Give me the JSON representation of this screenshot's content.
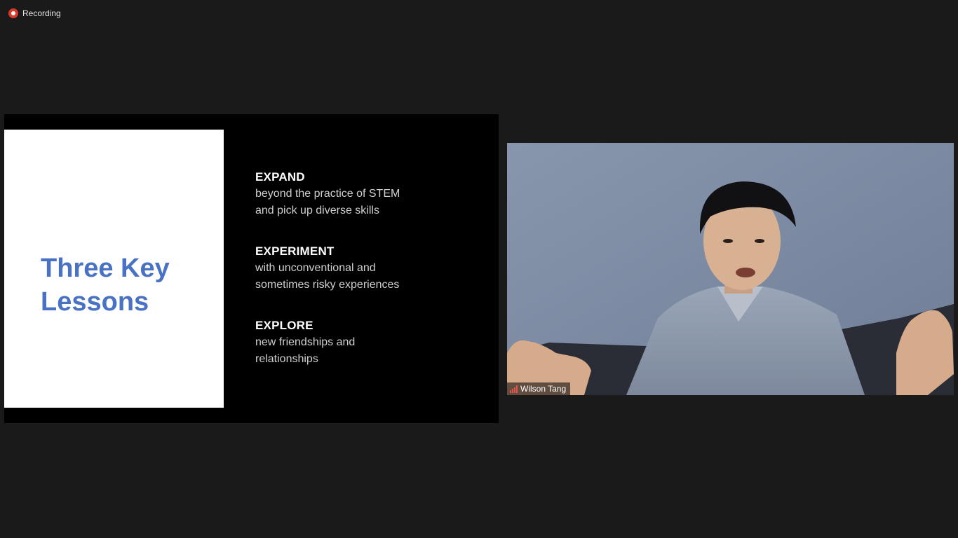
{
  "recording": {
    "label": "Recording",
    "icon": "record-icon",
    "color": "#d93a2b"
  },
  "slide": {
    "title_line1": "Three Key",
    "title_line2": "Lessons",
    "title_color": "#4a72c4",
    "lessons": [
      {
        "heading": "EXPAND",
        "line1": "beyond the practice of STEM",
        "line2": "and pick up diverse skills"
      },
      {
        "heading": "EXPERIMENT",
        "line1": "with unconventional and",
        "line2": "sometimes risky experiences"
      },
      {
        "heading": "EXPLORE",
        "line1": "new friendships and",
        "line2": "relationships"
      }
    ]
  },
  "participant": {
    "name": "Wilson Tang",
    "signal_icon": "signal-strength-icon",
    "signal_color": "#e4534a"
  }
}
